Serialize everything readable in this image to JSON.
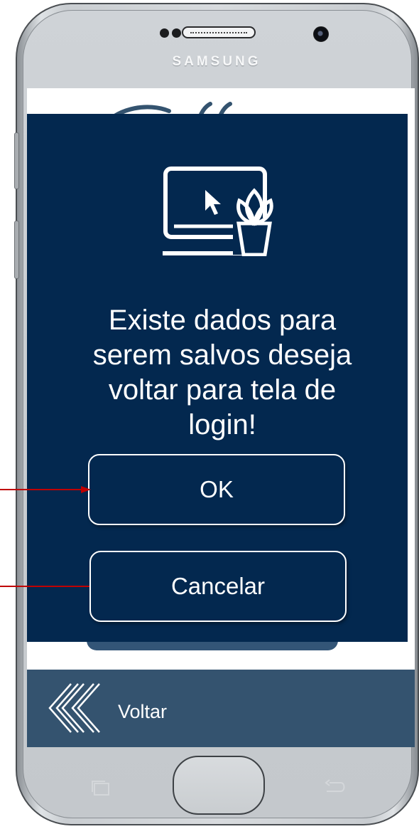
{
  "device": {
    "brand": "SAMSUNG"
  },
  "dialog": {
    "message_lines": [
      "Existe dados para",
      "serem salvos deseja",
      "voltar para tela de",
      "login!"
    ],
    "ok_label": "OK",
    "cancel_label": "Cancelar",
    "icon": "computer-with-plant-icon"
  },
  "footer": {
    "back_label": "Voltar",
    "back_icon": "double-chevron-left-icon"
  },
  "colors": {
    "dialog_bg": "#03284f",
    "footer_bg": "#34536f",
    "annotation_arrow": "#c00000"
  }
}
